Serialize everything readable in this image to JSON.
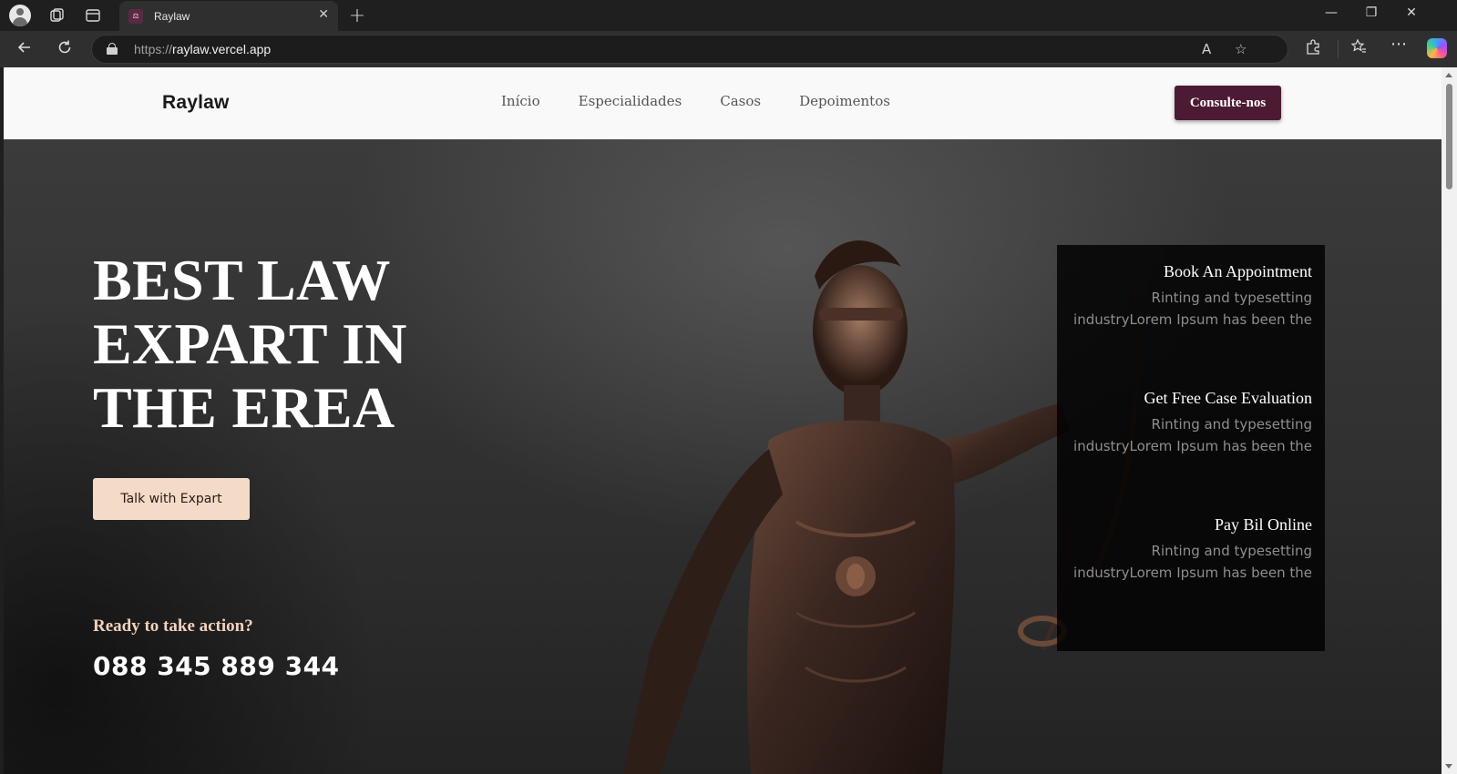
{
  "browser": {
    "tab_title": "Raylaw",
    "url_scheme": "https://",
    "url_host": "raylaw.vercel.app"
  },
  "site": {
    "logo": "Raylaw",
    "nav": [
      "Início",
      "Especialidades",
      "Casos",
      "Depoimentos"
    ],
    "cta": "Consulte-nos"
  },
  "hero": {
    "title_lines": [
      "BEST LAW",
      "EXPART IN",
      "THE EREA"
    ],
    "button": "Talk with Expart",
    "ready": "Ready to take action?",
    "phone": "088 345 889 344"
  },
  "services": [
    {
      "title": "Book An Appointment",
      "desc_lines": [
        "Rinting and typesetting",
        "industryLorem Ipsum has been the"
      ]
    },
    {
      "title": "Get Free Case Evaluation",
      "desc_lines": [
        "Rinting and typesetting",
        "industryLorem Ipsum has been the"
      ]
    },
    {
      "title": "Pay Bil Online",
      "desc_lines": [
        "Rinting and typesetting",
        "industryLorem Ipsum has been the"
      ]
    }
  ],
  "colors": {
    "brand": "#4d1a33",
    "hero_button": "#f3dbc8",
    "accent_text": "#f2d2bc"
  }
}
